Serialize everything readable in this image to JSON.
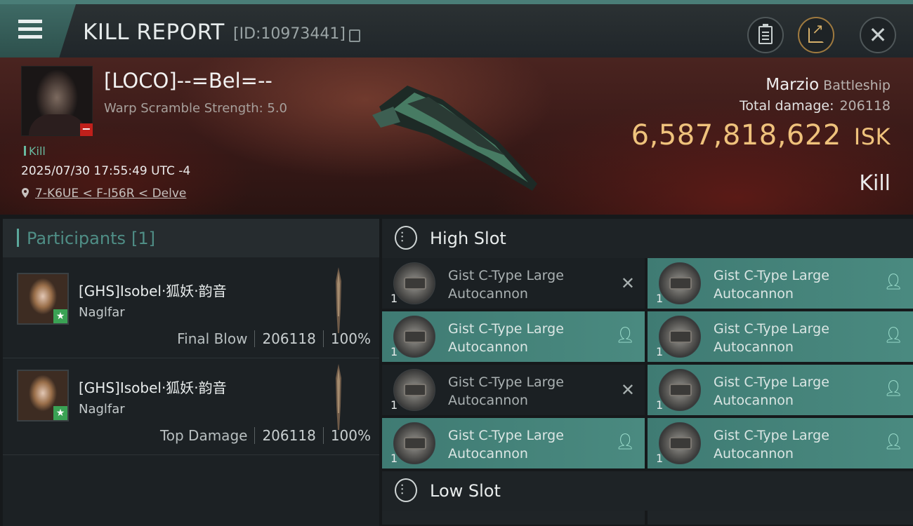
{
  "header": {
    "title": "KILL REPORT",
    "kill_id": "[ID:10973441]",
    "buttons": [
      "clipboard-icon",
      "share-icon",
      "close-icon"
    ]
  },
  "victim": {
    "name": "[LOCO]--=Bel=--",
    "subtitle": "Warp Scramble Strength: 5.0",
    "tag": "Kill",
    "datetime": "2025/07/30 17:55:49 UTC -4",
    "location": "7-K6UE < F-I56R < Delve",
    "ship": "Marzio",
    "ship_class": "Battleship",
    "total_damage_label": "Total damage:",
    "total_damage": "206118",
    "isk_value": "6,587,818,622",
    "isk_unit": "ISK",
    "result": "Kill"
  },
  "participants": {
    "title": "Participants",
    "count": "[1]",
    "rows": [
      {
        "name": "[GHS]Isobel·狐妖·韵音",
        "ship": "Naglfar",
        "label": "Final Blow",
        "damage": "206118",
        "percent": "100%"
      },
      {
        "name": "[GHS]Isobel·狐妖·韵音",
        "ship": "Naglfar",
        "label": "Top Damage",
        "damage": "206118",
        "percent": "100%"
      }
    ]
  },
  "high_slot": {
    "title": "High Slot",
    "items": [
      {
        "qty": "1",
        "line1": "Gist C-Type Large",
        "line2": "Autocannon",
        "state": "destroyed"
      },
      {
        "qty": "1",
        "line1": "Gist C-Type Large",
        "line2": "Autocannon",
        "state": "dropped"
      },
      {
        "qty": "1",
        "line1": "Gist C-Type Large",
        "line2": "Autocannon",
        "state": "dropped"
      },
      {
        "qty": "1",
        "line1": "Gist C-Type Large",
        "line2": "Autocannon",
        "state": "dropped"
      },
      {
        "qty": "1",
        "line1": "Gist C-Type Large",
        "line2": "Autocannon",
        "state": "destroyed"
      },
      {
        "qty": "1",
        "line1": "Gist C-Type Large",
        "line2": "Autocannon",
        "state": "dropped"
      },
      {
        "qty": "1",
        "line1": "Gist C-Type Large",
        "line2": "Autocannon",
        "state": "dropped"
      },
      {
        "qty": "1",
        "line1": "Gist C-Type Large",
        "line2": "Autocannon",
        "state": "dropped"
      }
    ]
  },
  "low_slot": {
    "title": "Low Slot"
  },
  "colors": {
    "accent_teal": "#4a8a80",
    "isk_gold": "#efc27c",
    "kill_green": "#68b99f"
  }
}
